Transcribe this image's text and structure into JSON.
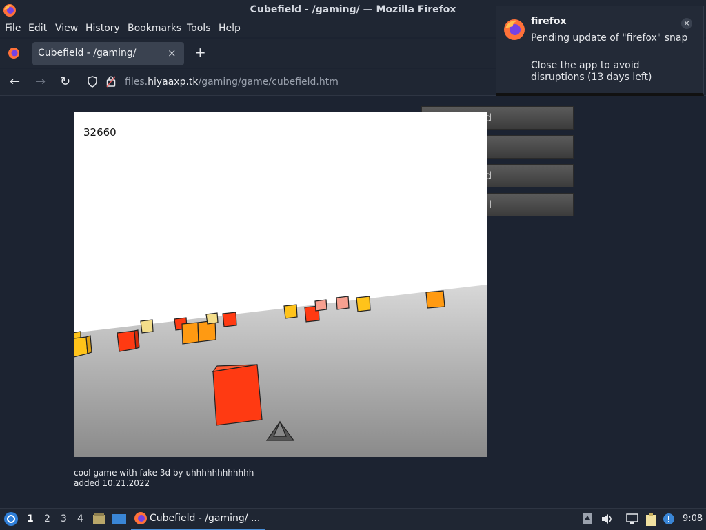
{
  "window": {
    "title": "Cubefield - /gaming/ — Mozilla Firefox"
  },
  "menu": [
    "File",
    "Edit",
    "View",
    "History",
    "Bookmarks",
    "Tools",
    "Help"
  ],
  "tab": {
    "label": "Cubefield - /gaming/",
    "close": "×",
    "new_tab": "+"
  },
  "nav": {
    "back": "←",
    "forward": "→",
    "reload": "↻"
  },
  "url": {
    "prefix": "files.",
    "domain": "hiyaaxp.tk",
    "path": "/gaming/game/cubefield.htm"
  },
  "side_buttons": [
    "d",
    "",
    "d",
    "l"
  ],
  "game": {
    "score": "32660"
  },
  "caption": {
    "line1": "cool game with fake 3d by uhhhhhhhhhhhh",
    "line2": "added 10.21.2022"
  },
  "notification": {
    "app": "firefox",
    "text1": "Pending update of \"firefox\" snap",
    "text2": "Close the app to avoid disruptions (13 days left)",
    "close": "×"
  },
  "taskbar": {
    "workspaces": [
      "1",
      "2",
      "3",
      "4"
    ],
    "active_workspace": "1",
    "task_label": "Cubefield - /gaming/ ...",
    "clock": "9:08"
  },
  "colors": {
    "accent": "#4a90d9",
    "cube_red": "#ff3a12",
    "cube_orange": "#ff9a12",
    "cube_yellow": "#ffc31a"
  }
}
